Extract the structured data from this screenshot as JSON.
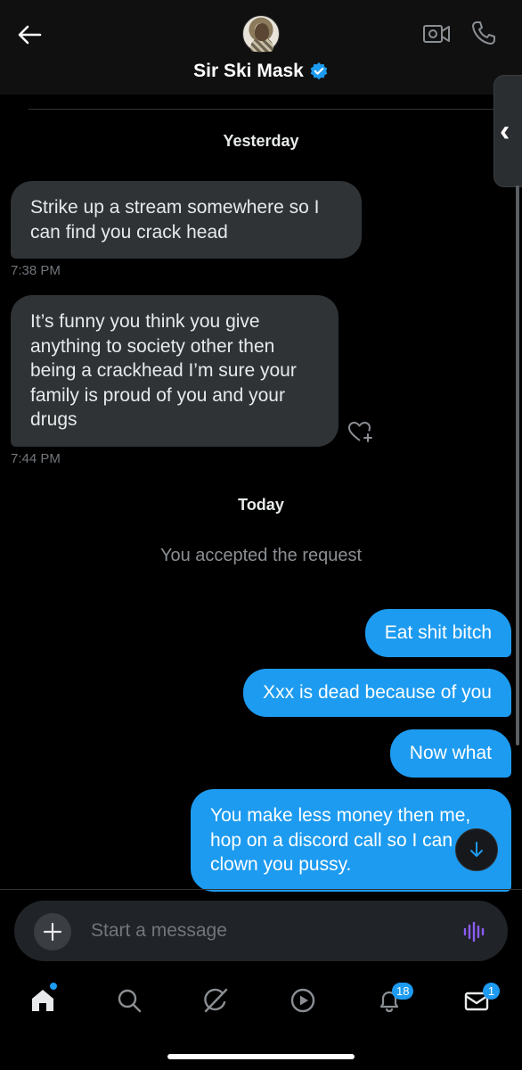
{
  "header": {
    "contact_name": "Sir Ski Mask",
    "verified": true,
    "icons": [
      "back-arrow-icon",
      "video-call-icon",
      "phone-call-icon",
      "verified-badge-icon"
    ]
  },
  "conversation": {
    "yesterday_label": "Yesterday",
    "today_label": "Today",
    "system_message": "You accepted the request",
    "incoming": [
      {
        "text_lines": [
          "Strike up a stream somewhere so I",
          "can find you crack head"
        ],
        "time": "7:38 PM"
      },
      {
        "text_lines": [
          "It’s funny you think you give",
          "anything to society other then",
          "being a crackhead I’m sure your",
          "family is proud of you and your",
          "drugs"
        ],
        "time": "7:44 PM"
      }
    ],
    "outgoing": [
      {
        "text_lines": [
          "Eat shit bitch"
        ]
      },
      {
        "text_lines": [
          "Xxx is dead because of you"
        ]
      },
      {
        "text_lines": [
          "Now what"
        ]
      },
      {
        "text_lines": [
          "You make less money then me,",
          "hop on a discord call so I can",
          "clown you pussy."
        ]
      }
    ]
  },
  "composer": {
    "placeholder": "Start a message"
  },
  "bottom_nav": {
    "items": [
      "home-icon",
      "search-icon",
      "grok-icon",
      "video-play-icon",
      "notifications-bell-icon",
      "messages-envelope-icon"
    ],
    "notifications_badge": "18",
    "messages_badge": "1"
  },
  "colors": {
    "accent": "#1d9bf0",
    "incoming_bubble": "#2f3336",
    "background": "#000000",
    "voice_icon": "#8b5cf6"
  }
}
